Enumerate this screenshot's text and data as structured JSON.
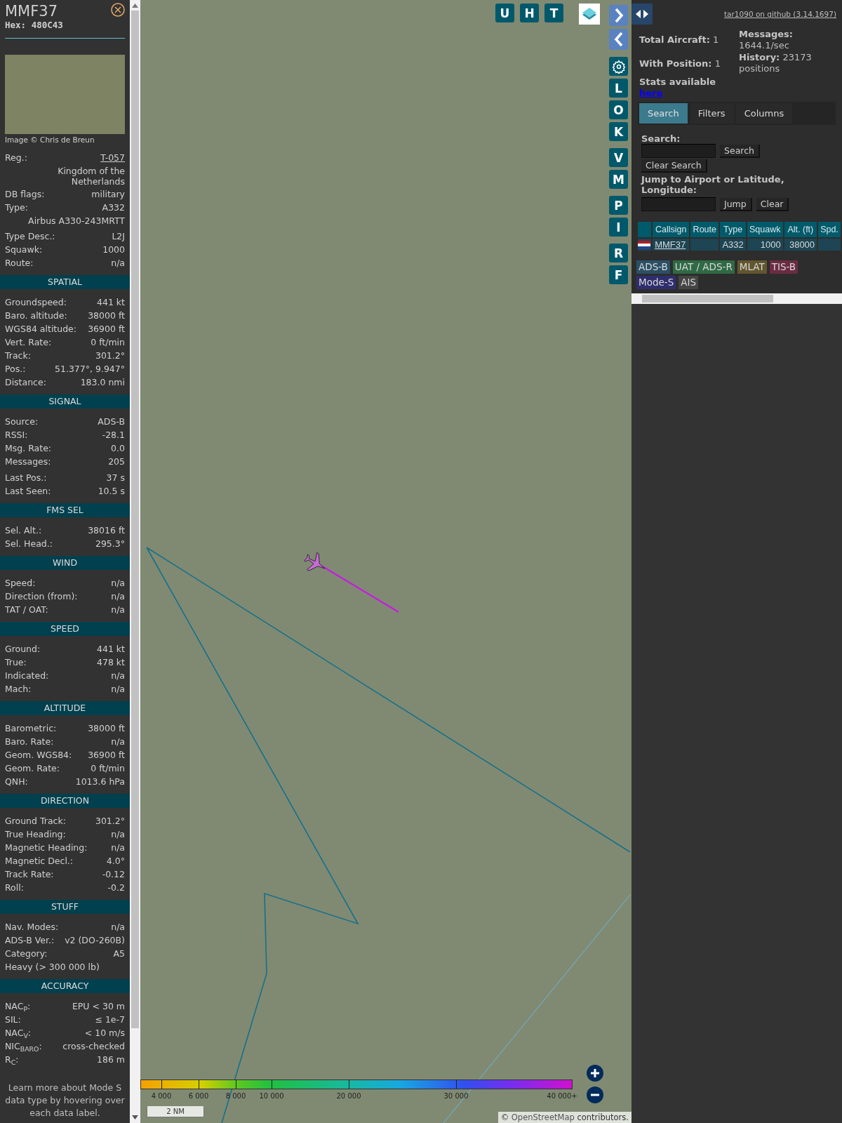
{
  "detail": {
    "callsign": "MMF37",
    "hex": "Hex: 480C43",
    "photo_credit": "Image © Chris de Breun",
    "overview": [
      [
        {
          "kind": "link",
          "label": "Reg.:",
          "value": "T-057"
        },
        {
          "kind": "value",
          "value": "Kingdom of the Netherlands"
        },
        {
          "kind": "pair",
          "label": "DB flags:",
          "value": "military"
        },
        {
          "kind": "pair",
          "label": "Type:",
          "value": "A332"
        },
        {
          "kind": "value",
          "value": "Airbus A330-243MRTT"
        }
      ],
      [
        {
          "kind": "pair",
          "label": "Type Desc.:",
          "value": "L2J"
        },
        {
          "kind": "pair",
          "label": "Squawk:",
          "value": "1000"
        },
        {
          "kind": "pair",
          "label": "Route:",
          "value": "n/a"
        }
      ]
    ],
    "sections": [
      {
        "title": "SPATIAL",
        "groups": [
          [
            {
              "kind": "pair",
              "label": "Groundspeed:",
              "value": "441 kt"
            },
            {
              "kind": "pair",
              "label": "Baro. altitude:",
              "value": "38000 ft"
            },
            {
              "kind": "pair",
              "label": "WGS84 altitude:",
              "value": "36900 ft"
            },
            {
              "kind": "pair",
              "label": "Vert. Rate:",
              "value": "0 ft/min"
            },
            {
              "kind": "pair",
              "label": "Track:",
              "value": "301.2°"
            },
            {
              "kind": "pair",
              "label": "Pos.:",
              "value": "51.377°, 9.947°"
            },
            {
              "kind": "pair",
              "label": "Distance:",
              "value": "183.0 nmi"
            }
          ]
        ]
      },
      {
        "title": "SIGNAL",
        "groups": [
          [
            {
              "kind": "pair",
              "label": "Source:",
              "value": "ADS-B"
            },
            {
              "kind": "pair",
              "label": "RSSI:",
              "value": "-28.1"
            },
            {
              "kind": "pair",
              "label": "Msg. Rate:",
              "value": "0.0"
            },
            {
              "kind": "pair",
              "label": "Messages:",
              "value": "205"
            }
          ],
          [
            {
              "kind": "pair",
              "label": "Last Pos.:",
              "value": "37 s"
            },
            {
              "kind": "pair",
              "label": "Last Seen:",
              "value": "10.5 s"
            }
          ]
        ]
      },
      {
        "title": "FMS SEL",
        "groups": [
          [
            {
              "kind": "pair",
              "label": "Sel. Alt.:",
              "value": "38016 ft"
            },
            {
              "kind": "pair",
              "label": "Sel. Head.:",
              "value": "295.3°"
            }
          ]
        ]
      },
      {
        "title": "WIND",
        "groups": [
          [
            {
              "kind": "pair",
              "label": "Speed:",
              "value": "n/a"
            },
            {
              "kind": "pair",
              "label": "Direction (from):",
              "value": "n/a"
            },
            {
              "kind": "pair",
              "label": "TAT / OAT:",
              "value": "n/a"
            }
          ]
        ]
      },
      {
        "title": "SPEED",
        "groups": [
          [
            {
              "kind": "pair",
              "label": "Ground:",
              "value": "441 kt"
            },
            {
              "kind": "pair",
              "label": "True:",
              "value": "478 kt"
            },
            {
              "kind": "pair",
              "label": "Indicated:",
              "value": "n/a"
            },
            {
              "kind": "pair",
              "label": "Mach:",
              "value": "n/a"
            }
          ]
        ]
      },
      {
        "title": "ALTITUDE",
        "groups": [
          [
            {
              "kind": "pair",
              "label": "Barometric:",
              "value": "38000 ft"
            },
            {
              "kind": "pair",
              "label": "Baro. Rate:",
              "value": "n/a"
            },
            {
              "kind": "pair",
              "label": "Geom. WGS84:",
              "value": "36900 ft"
            },
            {
              "kind": "pair",
              "label": "Geom. Rate:",
              "value": "0 ft/min"
            },
            {
              "kind": "pair",
              "label": "QNH:",
              "value": "1013.6 hPa"
            }
          ]
        ]
      },
      {
        "title": "DIRECTION",
        "groups": [
          [
            {
              "kind": "pair",
              "label": "Ground Track:",
              "value": "301.2°"
            },
            {
              "kind": "pair",
              "label": "True Heading:",
              "value": "n/a"
            },
            {
              "kind": "pair",
              "label": "Magnetic Heading:",
              "value": "n/a"
            },
            {
              "kind": "pair",
              "label": "Magnetic Decl.:",
              "value": "4.0°"
            },
            {
              "kind": "pair",
              "label": "Track Rate:",
              "value": "-0.12"
            },
            {
              "kind": "pair",
              "label": "Roll:",
              "value": "-0.2"
            }
          ]
        ]
      },
      {
        "title": "STUFF",
        "groups": [
          [
            {
              "kind": "pair",
              "label": "Nav. Modes:",
              "value": "n/a"
            },
            {
              "kind": "pair",
              "label": "ADS-B Ver.:",
              "value": "v2 (DO-260B)"
            },
            {
              "kind": "pair",
              "label": "Category:",
              "value": "A5"
            },
            {
              "kind": "note",
              "value": "Heavy (> 300 000 lb)"
            }
          ]
        ]
      },
      {
        "title": "ACCURACY",
        "groups": [
          [
            {
              "kind": "pair",
              "label": "NAC$_{P}$:",
              "value": "EPU < 30 m"
            },
            {
              "kind": "pair",
              "label": "SIL:",
              "value": "≤ 1e-7"
            },
            {
              "kind": "pair",
              "label": "NAC$_{V}$:",
              "value": "< 10 m/s"
            },
            {
              "kind": "pair",
              "label": "NIC$_{BARO}$:",
              "value": "cross-checked"
            },
            {
              "kind": "pair",
              "label": "R$_{C}$:",
              "value": "186 m"
            }
          ]
        ]
      }
    ],
    "learn_more": "Learn more about Mode S data type by hovering over each data label."
  },
  "map": {
    "top_buttons": [
      "U",
      "H",
      "T"
    ],
    "side_groups": [
      [
        {
          "kind": "arrow_right"
        },
        {
          "kind": "arrow_left"
        }
      ],
      [
        {
          "kind": "settings"
        },
        {
          "kind": "letter",
          "label": "L"
        },
        {
          "kind": "letter",
          "label": "O"
        },
        {
          "kind": "letter",
          "label": "K"
        }
      ],
      [
        {
          "kind": "letter",
          "label": "V"
        },
        {
          "kind": "letter",
          "label": "M"
        }
      ],
      [
        {
          "kind": "letter",
          "label": "P"
        },
        {
          "kind": "letter",
          "label": "I"
        }
      ],
      [
        {
          "kind": "letter",
          "label": "R"
        },
        {
          "kind": "letter",
          "label": "F"
        }
      ]
    ],
    "altitude_legend": [
      "4 000",
      "6 000",
      "8 000",
      "10 000",
      "20 000",
      "30 000",
      "40 000+"
    ],
    "scale": "2 NM",
    "attribution": {
      "prefix": "©",
      "link": "OpenStreetMap",
      "suffix": "contributors."
    }
  },
  "panel": {
    "github_link": "tar1090 on github (3.14.1697)",
    "stats_left": [
      {
        "label": "Total Aircraft:",
        "value": "1"
      },
      {
        "label": "With Position:",
        "value": "1"
      }
    ],
    "stats_available": {
      "label": "Stats available",
      "link": "here"
    },
    "stats_right": [
      {
        "label": "Messages:",
        "value": "1644.1/sec"
      },
      {
        "label": "History:",
        "value": "23173 positions"
      }
    ],
    "tabs": [
      {
        "label": "Search",
        "selected": true
      },
      {
        "label": "Filters",
        "selected": false
      },
      {
        "label": "Columns",
        "selected": false
      }
    ],
    "search": {
      "label": "Search:",
      "button": "Search",
      "clear_button": "Clear Search",
      "jump_label": "Jump to Airport or Latitude, Longitude:",
      "jump_button": "Jump",
      "jump_clear": "Clear"
    },
    "table": {
      "columns": [
        "Callsign",
        "Route",
        "Type",
        "Squawk",
        "Alt. (ft)",
        "Spd."
      ],
      "rows": [
        {
          "selected": false,
          "cells": [
            "MMF37",
            null,
            "A332",
            "1000",
            "38000",
            null
          ]
        }
      ]
    },
    "source_tags": [
      {
        "label": "ADS-B",
        "color": "#2b5066"
      },
      {
        "label": "UAT / ADS-R",
        "color": "#2f6a44"
      },
      {
        "label": "MLAT",
        "color": "#62562f"
      },
      {
        "label": "TIS-B",
        "color": "#6b2b43"
      },
      {
        "label": "Mode-S",
        "color": "#2e2e6e"
      },
      {
        "label": "AIS",
        "color": "#454545"
      }
    ]
  }
}
